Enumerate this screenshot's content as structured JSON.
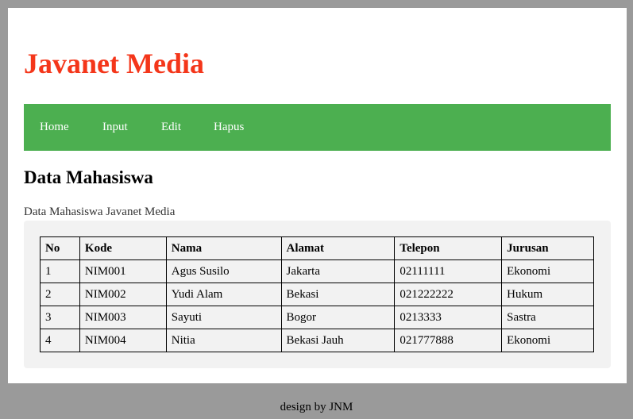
{
  "header": {
    "site_title": "Javanet Media"
  },
  "nav": {
    "items": [
      {
        "label": "Home"
      },
      {
        "label": "Input"
      },
      {
        "label": "Edit"
      },
      {
        "label": "Hapus"
      }
    ]
  },
  "main": {
    "title": "Data Mahasiswa",
    "subtitle": "Data Mahasiswa Javanet Media",
    "table": {
      "columns": [
        "No",
        "Kode",
        "Nama",
        "Alamat",
        "Telepon",
        "Jurusan"
      ],
      "rows": [
        [
          "1",
          "NIM001",
          "Agus Susilo",
          "Jakarta",
          "02111111",
          "Ekonomi"
        ],
        [
          "2",
          "NIM002",
          "Yudi Alam",
          "Bekasi",
          "021222222",
          "Hukum"
        ],
        [
          "3",
          "NIM003",
          "Sayuti",
          "Bogor",
          "0213333",
          "Sastra"
        ],
        [
          "4",
          "NIM004",
          "Nitia",
          "Bekasi Jauh",
          "021777888",
          "Ekonomi"
        ]
      ]
    }
  },
  "footer": {
    "text": "design by JNM"
  },
  "colors": {
    "brand": "#f4361a",
    "navbar": "#4caf50",
    "outer_background": "#9a9a9a",
    "panel_background": "#f2f2f2"
  }
}
